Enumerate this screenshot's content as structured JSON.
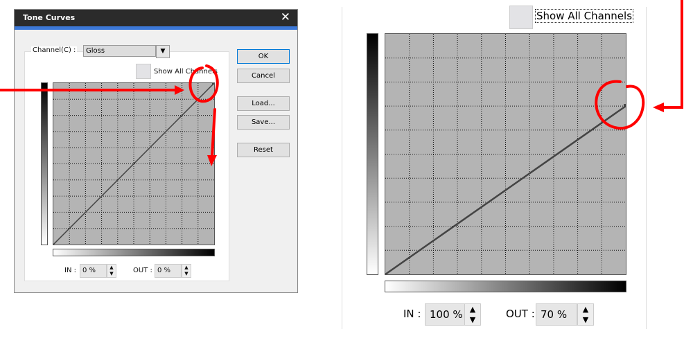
{
  "dialog": {
    "title": "Tone Curves",
    "close_icon": "close-icon",
    "channel_label": "Channel(C) :",
    "channel_value": "Gloss",
    "show_all_channels": "Show All Channels",
    "buttons": {
      "ok": "OK",
      "cancel": "Cancel",
      "load": "Load...",
      "save": "Save...",
      "reset": "Reset"
    },
    "in_label": "IN :",
    "in_value": "0 %",
    "out_label": "OUT :",
    "out_value": "0 %",
    "curve_end_percent": [
      100,
      100
    ]
  },
  "zoomed": {
    "show_all_channels": "Show All Channels",
    "in_label": "IN :",
    "in_value": "100 %",
    "out_label": "OUT :",
    "out_value": "70 %",
    "curve_end_percent": [
      100,
      70
    ]
  },
  "colors": {
    "annotation": "#ff0000",
    "accent": "#3c78d8",
    "grid": "#b4b4b4"
  }
}
